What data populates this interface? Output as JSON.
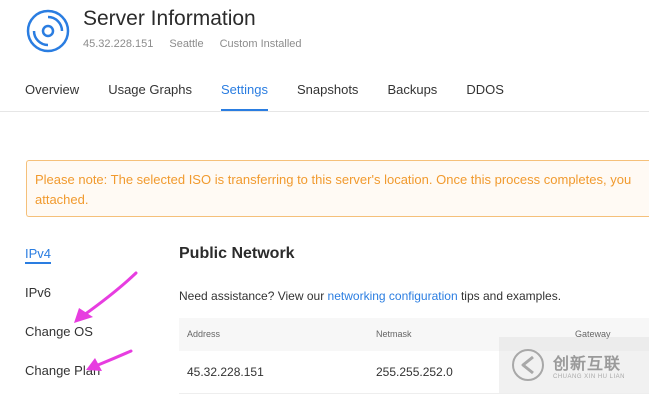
{
  "header": {
    "title": "Server Information",
    "ip": "45.32.228.151",
    "location": "Seattle",
    "os": "Custom Installed",
    "icon": "server-disc-icon"
  },
  "tabs": [
    {
      "label": "Overview",
      "active": false
    },
    {
      "label": "Usage Graphs",
      "active": false
    },
    {
      "label": "Settings",
      "active": true
    },
    {
      "label": "Snapshots",
      "active": false
    },
    {
      "label": "Backups",
      "active": false
    },
    {
      "label": "DDOS",
      "active": false
    }
  ],
  "notice": {
    "text": "Please note: The selected ISO is transferring to this server's location. Once this process completes, you",
    "text2": "attached."
  },
  "side_nav": [
    {
      "label": "IPv4",
      "active": true
    },
    {
      "label": "IPv6",
      "active": false
    },
    {
      "label": "Change OS",
      "active": false
    },
    {
      "label": "Change Plan",
      "active": false
    }
  ],
  "section": {
    "title": "Public Network",
    "assist_prefix": "Need assistance? View our",
    "assist_link": "networking configuration",
    "assist_suffix": "tips and examples."
  },
  "table": {
    "headers": [
      "Address",
      "Netmask",
      "Gateway"
    ],
    "row": [
      "45.32.228.151",
      "255.255.252.0",
      ""
    ]
  },
  "watermark": {
    "cn": "创新互联",
    "en": "CHUANG XIN HU LIAN"
  },
  "colors": {
    "accent": "#2a7de1",
    "notice_text": "#f19a2e",
    "notice_border": "#f5c07a",
    "arrow": "#e73de0"
  }
}
